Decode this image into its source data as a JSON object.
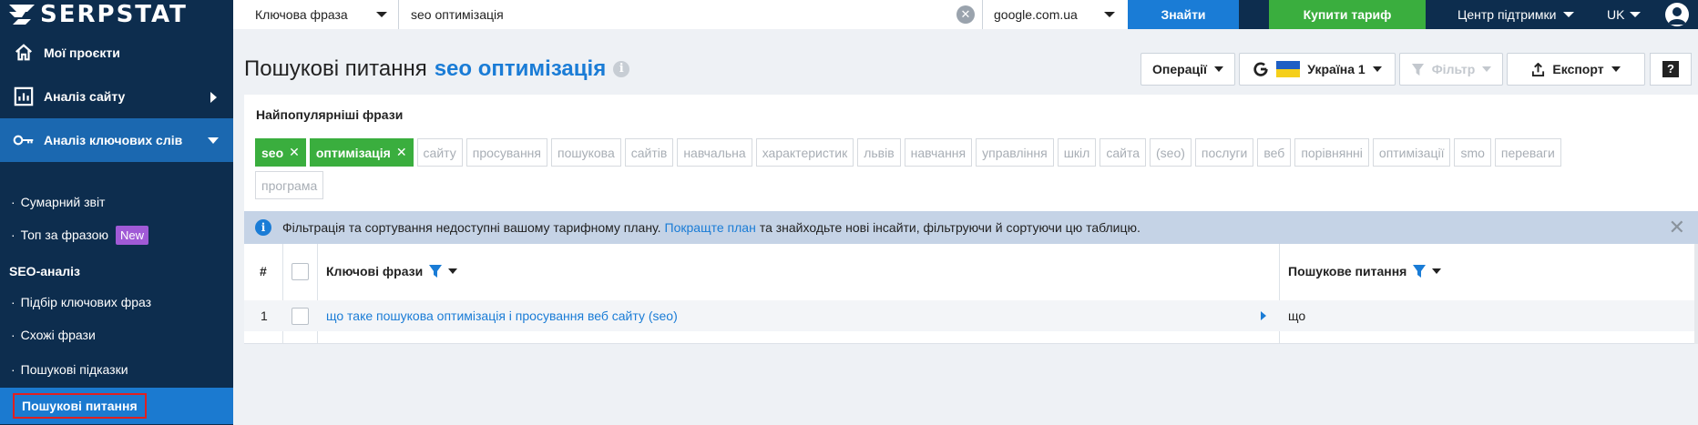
{
  "topbar": {
    "logo_text": "SERPSTAT",
    "search_type": "Ключова фраза",
    "query": "seo оптимізація",
    "domain": "google.com.ua",
    "find_label": "Знайти",
    "buy_label": "Купити тариф",
    "support_label": "Центр підтримки",
    "lang_label": "UK"
  },
  "sidebar": {
    "nav": [
      {
        "label": "Мої проєкти",
        "icon": "home-icon"
      },
      {
        "label": "Аналіз сайту",
        "icon": "site-analysis-icon"
      },
      {
        "label": "Аналіз ключових слів",
        "icon": "key-icon"
      }
    ],
    "sub": [
      {
        "label": "Сумарний звіт"
      },
      {
        "label": "Топ за фразою",
        "badge": "New"
      }
    ],
    "section": "SEO-аналіз",
    "seo_items": [
      {
        "label": "Підбір ключових фраз"
      },
      {
        "label": "Схожі фрази"
      },
      {
        "label": "Пошукові підказки"
      },
      {
        "label": "Пошукові питання"
      }
    ]
  },
  "header": {
    "title_prefix": "Пошукові питання",
    "title_keyword": "seo оптимізація",
    "operations_label": "Операції",
    "region_label": "Україна 1",
    "filter_label": "Фільтр",
    "export_label": "Експорт",
    "help_label": "?"
  },
  "phrases": {
    "title": "Найпопулярніші фрази",
    "active": [
      "seo",
      "оптимізація"
    ],
    "tags": [
      "сайту",
      "просування",
      "пошукова",
      "сайтів",
      "навчальна",
      "характеристик",
      "львів",
      "навчання",
      "управління",
      "шкіл",
      "сайта",
      "(seo)",
      "послуги",
      "веб",
      "порівнянні",
      "оптимізації",
      "smo",
      "переваги",
      "програма"
    ]
  },
  "notice": {
    "text_before": "Фільтрація та сортування недоступні вашому тарифному плану.",
    "link": "Покращте план",
    "text_after": "та знайходьте нові інсайти, фільтруючи й сортуючи цю таблицю."
  },
  "table": {
    "col_num": "#",
    "col_keyword": "Ключові фрази",
    "col_question": "Пошукове питання",
    "rows": [
      {
        "num": "1",
        "keyword": "що таке пошукова оптимізація і просування веб сайту (seo)",
        "question": "що"
      }
    ]
  },
  "colors": {
    "navy": "#0d2d4e",
    "accent_blue": "#1a7cd6",
    "green": "#3aae3e",
    "badge_purple": "#a05ad6"
  }
}
